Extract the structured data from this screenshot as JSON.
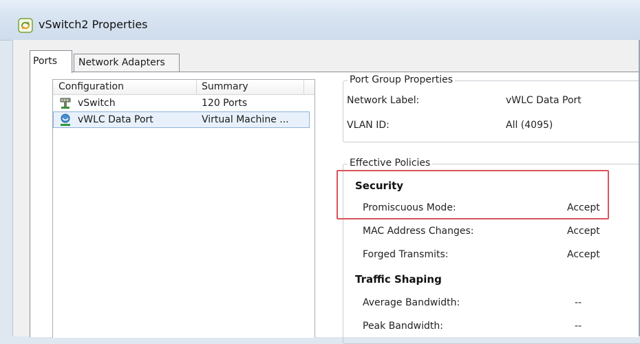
{
  "window": {
    "title": "vSwitch2 Properties",
    "icon": "vswitch-properties-icon"
  },
  "tabs": [
    {
      "label": "Ports",
      "selected": true
    },
    {
      "label": "Network Adapters",
      "selected": false
    }
  ],
  "port_list": {
    "columns": [
      "Configuration",
      "Summary"
    ],
    "rows": [
      {
        "icon": "vswitch-icon",
        "name": "vSwitch",
        "summary": "120 Ports",
        "selected": false
      },
      {
        "icon": "port-group-icon",
        "name": "vWLC Data Port",
        "summary": "Virtual Machine ...",
        "selected": true
      }
    ]
  },
  "port_group_properties": {
    "title": "Port Group Properties",
    "network_label": {
      "label": "Network Label:",
      "value": "vWLC Data Port"
    },
    "vlan_id": {
      "label": "VLAN ID:",
      "value": "All (4095)"
    }
  },
  "effective_policies": {
    "title": "Effective Policies",
    "security": {
      "heading": "Security",
      "promiscuous_mode": {
        "label": "Promiscuous Mode:",
        "value": "Accept"
      },
      "mac_address_changes": {
        "label": "MAC Address Changes:",
        "value": "Accept"
      },
      "forged_transmits": {
        "label": "Forged Transmits:",
        "value": "Accept"
      }
    },
    "traffic_shaping": {
      "heading": "Traffic Shaping",
      "average_bandwidth": {
        "label": "Average Bandwidth:",
        "value": "--"
      },
      "peak_bandwidth": {
        "label": "Peak Bandwidth:",
        "value": "--"
      }
    }
  },
  "colors": {
    "highlight_border": "#d9535a",
    "selection_border": "#8fb2d8"
  }
}
